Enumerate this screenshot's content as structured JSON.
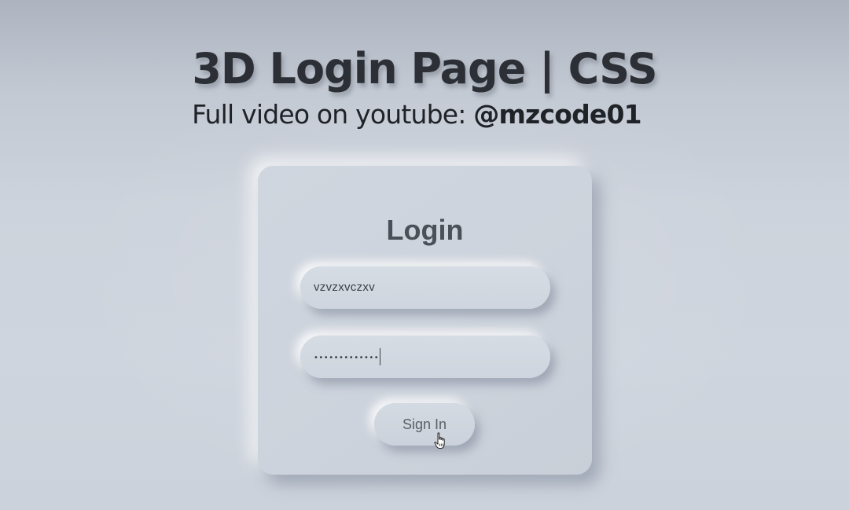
{
  "header": {
    "title": "3D Login Page | CSS",
    "subtitle_prefix": "Full video on youtube: ",
    "subtitle_handle": "@mzcode01"
  },
  "login_card": {
    "title": "Login",
    "username": {
      "value": "vzvzxvczxv",
      "placeholder": ""
    },
    "password": {
      "masked_value": "•••••••••••••"
    },
    "submit_label": "Sign In"
  },
  "icons": {
    "cursor": "hand-pointer-icon"
  },
  "colors": {
    "background": "#cdd3dc",
    "card": "#cfd5de",
    "title_text": "#2c3036",
    "card_text": "#4a5057"
  }
}
